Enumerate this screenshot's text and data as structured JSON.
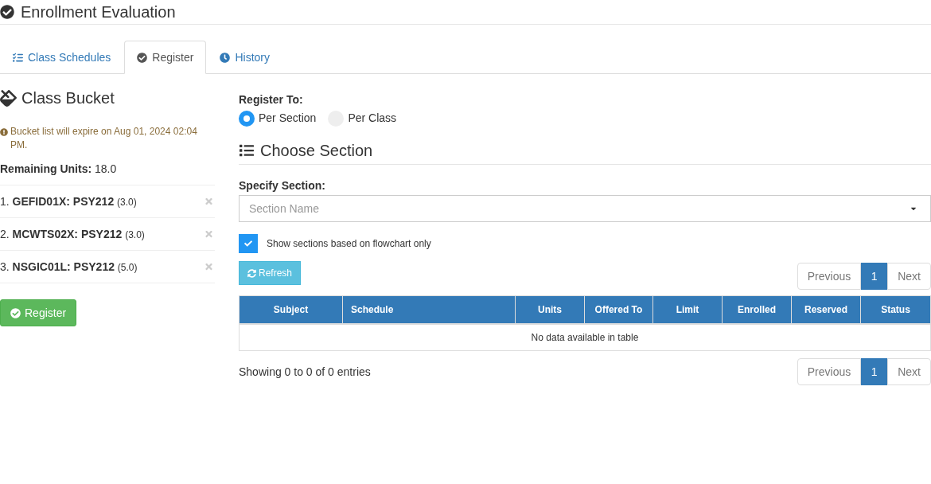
{
  "page": {
    "title": "Enrollment Evaluation"
  },
  "tabs": [
    {
      "label": "Class Schedules",
      "selected": false
    },
    {
      "label": "Register",
      "selected": true
    },
    {
      "label": "History",
      "selected": false
    }
  ],
  "bucket": {
    "title": "Class Bucket",
    "notice": "Bucket list will expire on Aug 01, 2024 02:04 PM.",
    "remaining": "**Remaining Units:** 18.0",
    "items": [
      {
        "text": "1. **GEFID01X: PSY212**",
        "units": "(3.0)"
      },
      {
        "text": "2. **MCWTS02X: PSY212**",
        "units": "(3.0)"
      },
      {
        "text": "3. **NSGIC01L: PSY212**",
        "units": "(5.0)"
      }
    ],
    "register_button": "Register"
  },
  "register_to": {
    "label": "Register To:",
    "options": [
      {
        "label": "Per Section",
        "selected": true
      },
      {
        "label": "Per Class",
        "selected": false
      }
    ]
  },
  "choose_section": {
    "title": "Choose Section",
    "field_label": "Specify Section:",
    "select": {
      "placeholder": "Section Name"
    },
    "flowchart_only": {
      "label": "Show sections based on flowchart only",
      "checked": true
    },
    "refresh_button": "Refresh"
  },
  "pagination_top": {
    "previous": {
      "label": "Previous",
      "disabled": true
    },
    "pages": [
      {
        "label": "1",
        "selected": true
      }
    ],
    "next": {
      "label": "Next",
      "disabled": true
    }
  },
  "table": {
    "columns": [
      "Subject",
      "Schedule",
      "Units",
      "Offered To",
      "Limit",
      "Enrolled",
      "Reserved",
      "Status"
    ],
    "empty_message": "No data available in table"
  },
  "footer": {
    "info": "Showing 0 to 0 of 0 entries"
  },
  "pagination_bottom": {
    "previous": {
      "label": "Previous",
      "disabled": true
    },
    "pages": [
      {
        "label": "1",
        "selected": true
      }
    ],
    "next": {
      "label": "Next",
      "disabled": true
    }
  }
}
